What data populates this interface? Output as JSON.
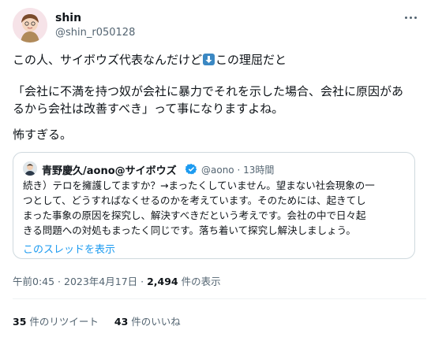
{
  "author": {
    "name": "shin",
    "handle": "@shin_r050128"
  },
  "tweet": {
    "line1_a": "この人、サイボウズ代表なんだけど",
    "line1_b": "この理屈だと",
    "line2": "「会社に不満を持つ奴が会社に暴力でそれを示した場合、会社に原因があ",
    "line3": "るから会社は改善すべき」って事になりますよね。",
    "line4": "怖すぎる。"
  },
  "quote": {
    "name": "青野慶久/aono@サイボウズ",
    "handle": "@aono · 13時間",
    "lines": [
      "続き）テロを擁護してますか？→まったくしていません。望まない社会現象の一",
      "つとして、どうすればなくせるのかを考えています。そのためには、起きてし",
      "まった事象の原因を探究し、解決すべきだという考えです。会社の中で日々起",
      "きる問題への対処もまったく同じです。落ち着いて探究し解決しましょう。"
    ],
    "thread_link": "このスレッドを表示"
  },
  "meta": {
    "time": "午前0:45 · 2023年4月17日 · ",
    "views_count": "2,494",
    "views_label": " 件の表示"
  },
  "stats": {
    "retweets_count": "35",
    "retweets_label": " 件のリツイート",
    "likes_count": "43",
    "likes_label": " 件のいいね"
  },
  "colors": {
    "link": "#1d9bf0",
    "secondary": "#536471",
    "verified": "#1d9bf0"
  },
  "icons": {
    "more": "more-dots-icon",
    "arrow": "down-arrow-emoji-icon",
    "verified": "verified-badge-icon"
  }
}
